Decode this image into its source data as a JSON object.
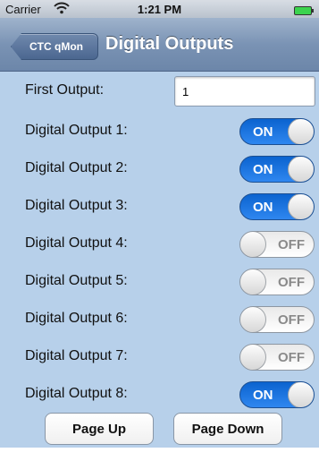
{
  "status_bar": {
    "carrier": "Carrier",
    "time": "1:21 PM",
    "wifi_icon": "wifi-icon",
    "battery_icon": "battery-icon",
    "battery_color": "#3bd34e"
  },
  "nav": {
    "back_label": "CTC qMon",
    "title": "Digital Outputs"
  },
  "form": {
    "first_output_label": "First Output:",
    "first_output_value": "1"
  },
  "outputs": [
    {
      "label": "Digital Output 1:",
      "state": "ON"
    },
    {
      "label": "Digital Output 2:",
      "state": "ON"
    },
    {
      "label": "Digital Output 3:",
      "state": "ON"
    },
    {
      "label": "Digital Output 4:",
      "state": "OFF"
    },
    {
      "label": "Digital Output 5:",
      "state": "OFF"
    },
    {
      "label": "Digital Output 6:",
      "state": "OFF"
    },
    {
      "label": "Digital Output 7:",
      "state": "OFF"
    },
    {
      "label": "Digital Output 8:",
      "state": "ON"
    }
  ],
  "buttons": {
    "page_up": "Page Up",
    "page_down": "Page Down"
  },
  "colors": {
    "content_bg": "#b7d0ea",
    "toggle_on": "#1f75e2",
    "nav_bg": "#7a93b4"
  }
}
